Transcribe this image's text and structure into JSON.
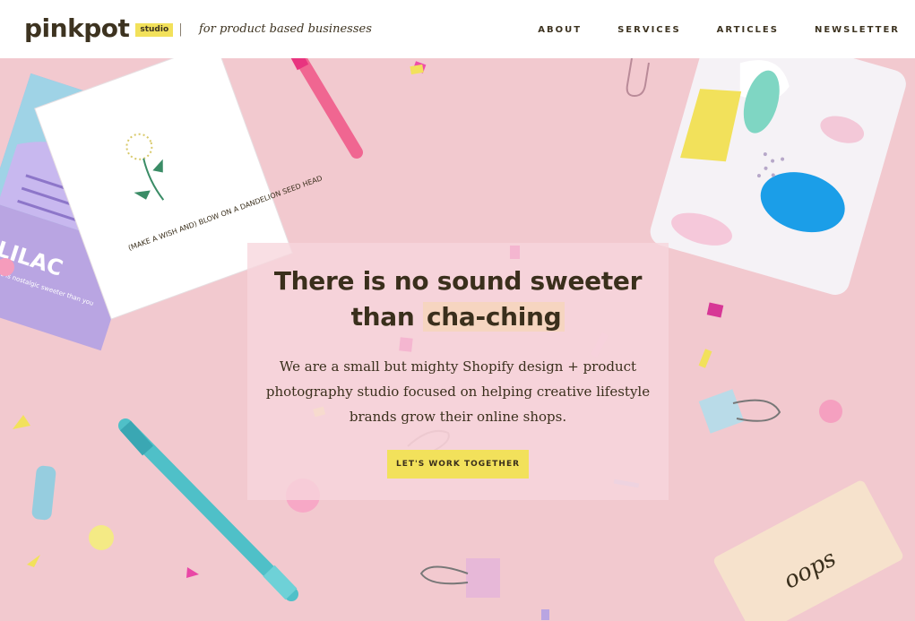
{
  "header": {
    "logo_text": "pinkpot",
    "logo_badge": "studio",
    "divider": "|",
    "tagline": "for product based businesses",
    "nav": [
      {
        "label": "ABOUT"
      },
      {
        "label": "SERVICES"
      },
      {
        "label": "ARTICLES"
      },
      {
        "label": "NEWSLETTER"
      }
    ]
  },
  "hero": {
    "headline_line1": "There is no sound sweeter",
    "headline_line2_pre": "than",
    "headline_highlight": "cha-ching",
    "subtext": "We are a small but mighty Shopify design + product photography studio focused on helping creative lifestyle brands grow their online shops.",
    "cta_label": "LET'S WORK TOGETHER"
  },
  "props": {
    "card_text": "(MAKE A WISH AND) BLOW ON A DANDELION SEED HEAD",
    "lilac_title": "LILAC",
    "lilac_text": "Lilac is nostalgic sweeter than you",
    "eraser_text": "oops"
  },
  "colors": {
    "background": "#f2c9cf",
    "accent_yellow": "#f2e15b",
    "text_dark": "#3a2f1c",
    "highlight": "#f6d5c0"
  }
}
